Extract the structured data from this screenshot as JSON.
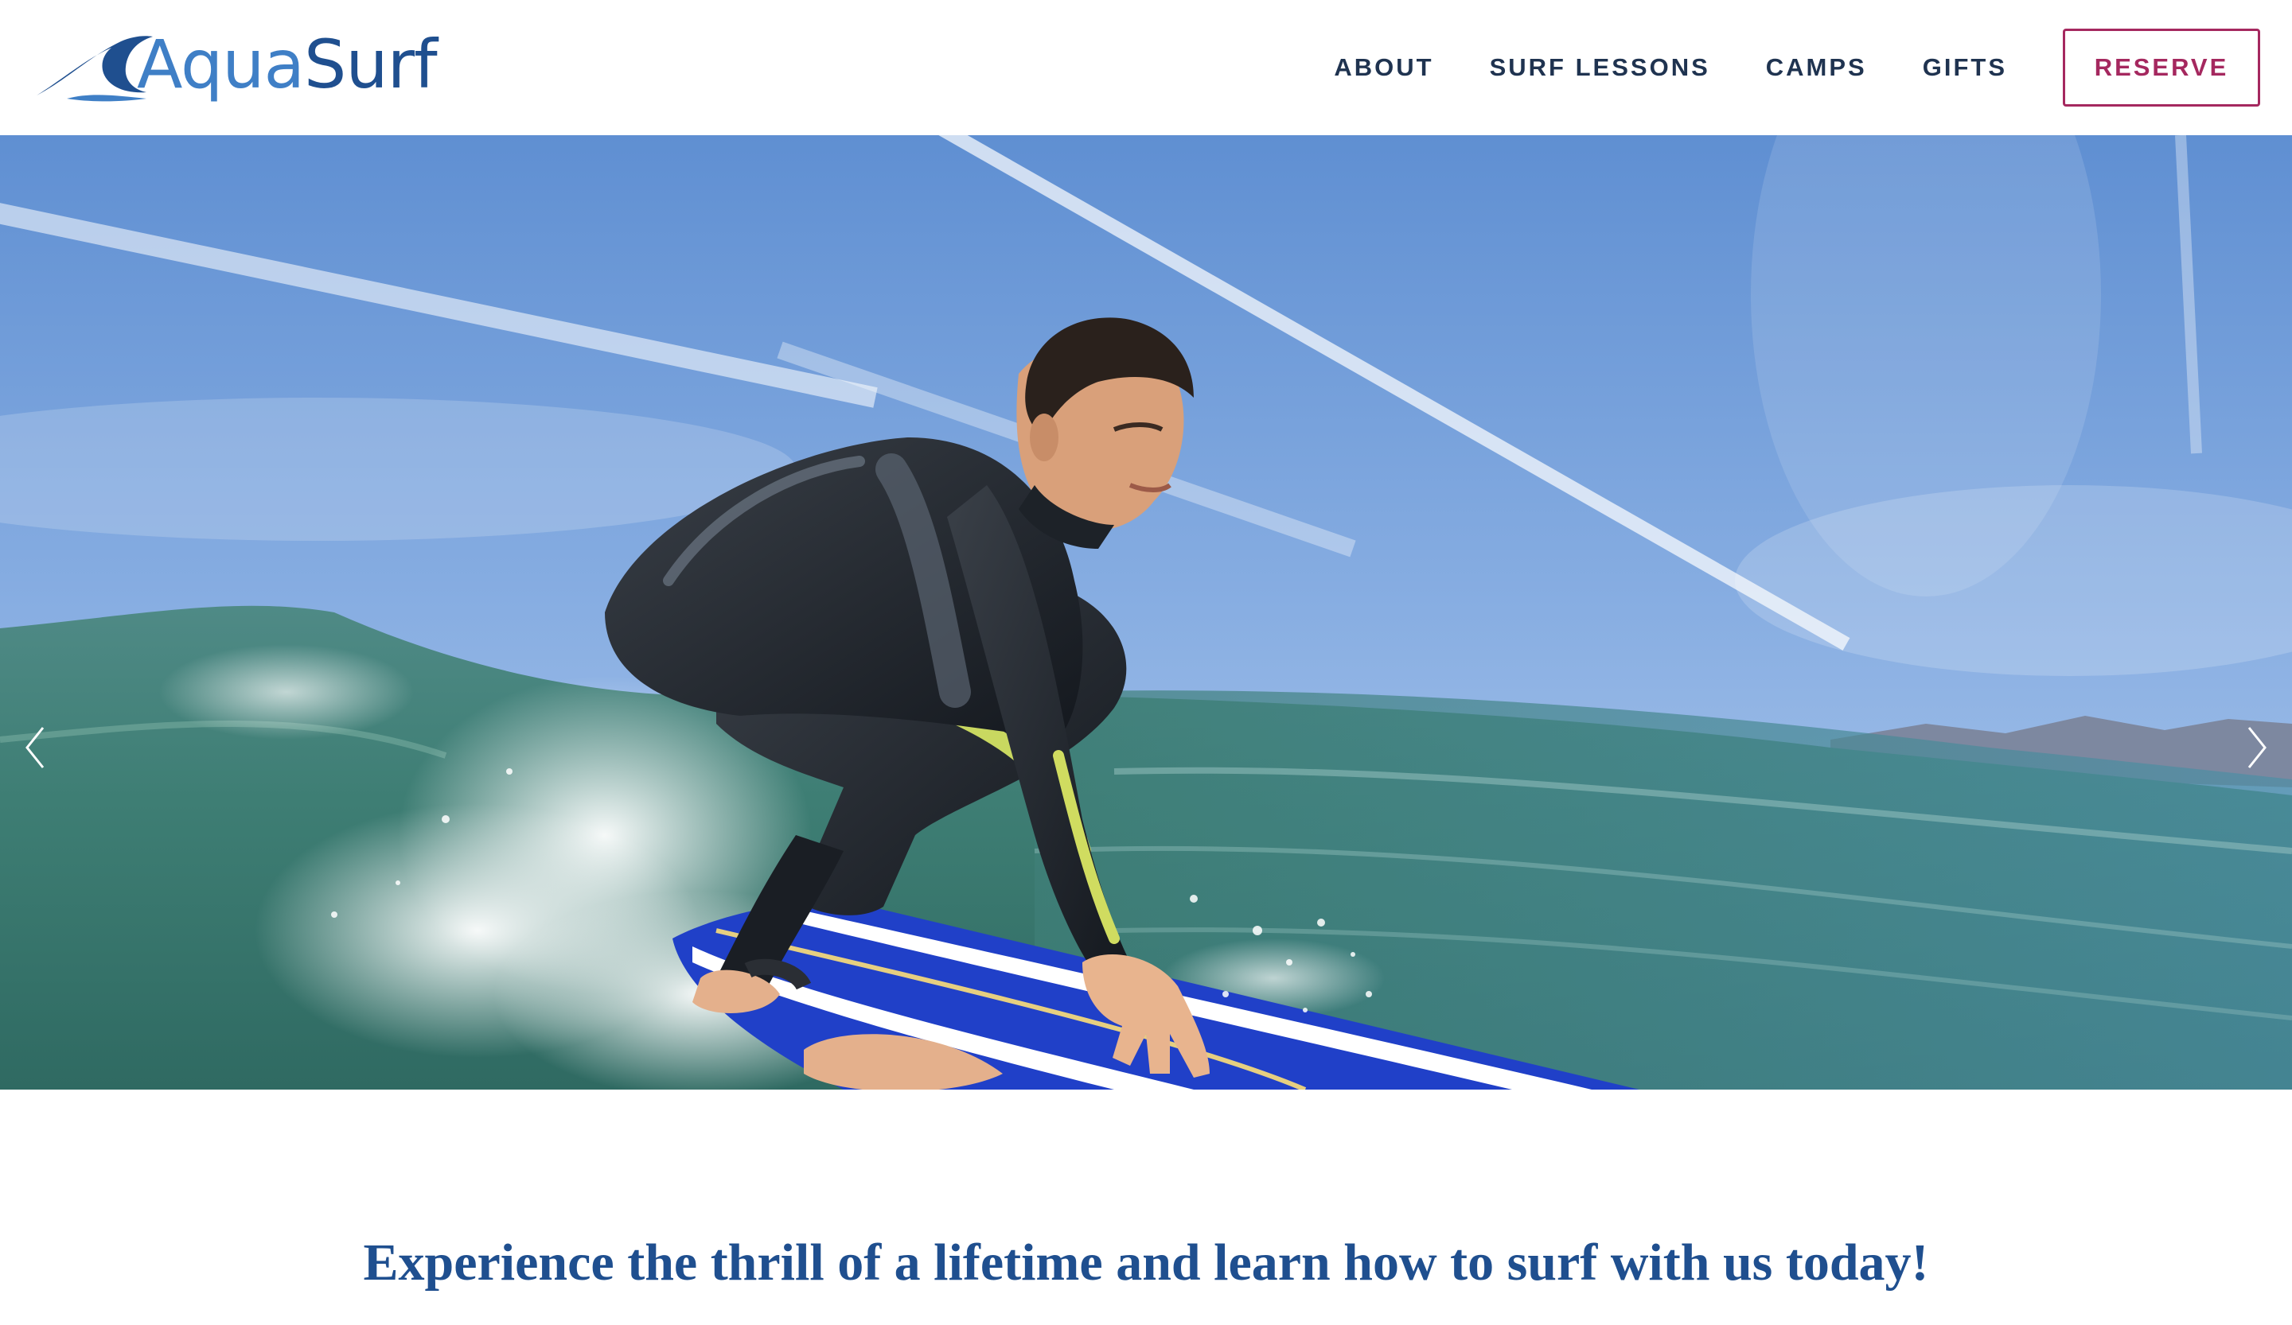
{
  "brand": {
    "logo_part1": "Aqua",
    "logo_part2": "Surf",
    "logo_icon": "wave-icon",
    "colors": {
      "primary": "#1f4f8f",
      "secondary": "#3f7fc6",
      "accent": "#a5285f",
      "nav_text": "#1f3350"
    }
  },
  "nav": {
    "items": [
      {
        "label": "ABOUT"
      },
      {
        "label": "SURF LESSONS"
      },
      {
        "label": "CAMPS"
      },
      {
        "label": "GIFTS"
      }
    ],
    "cta_label": "RESERVE"
  },
  "hero": {
    "image_subject": "surfer-on-wave-photo",
    "prev_icon": "chevron-left-icon",
    "next_icon": "chevron-right-icon"
  },
  "tagline": "Experience the thrill of a lifetime and learn how to surf with us today!"
}
